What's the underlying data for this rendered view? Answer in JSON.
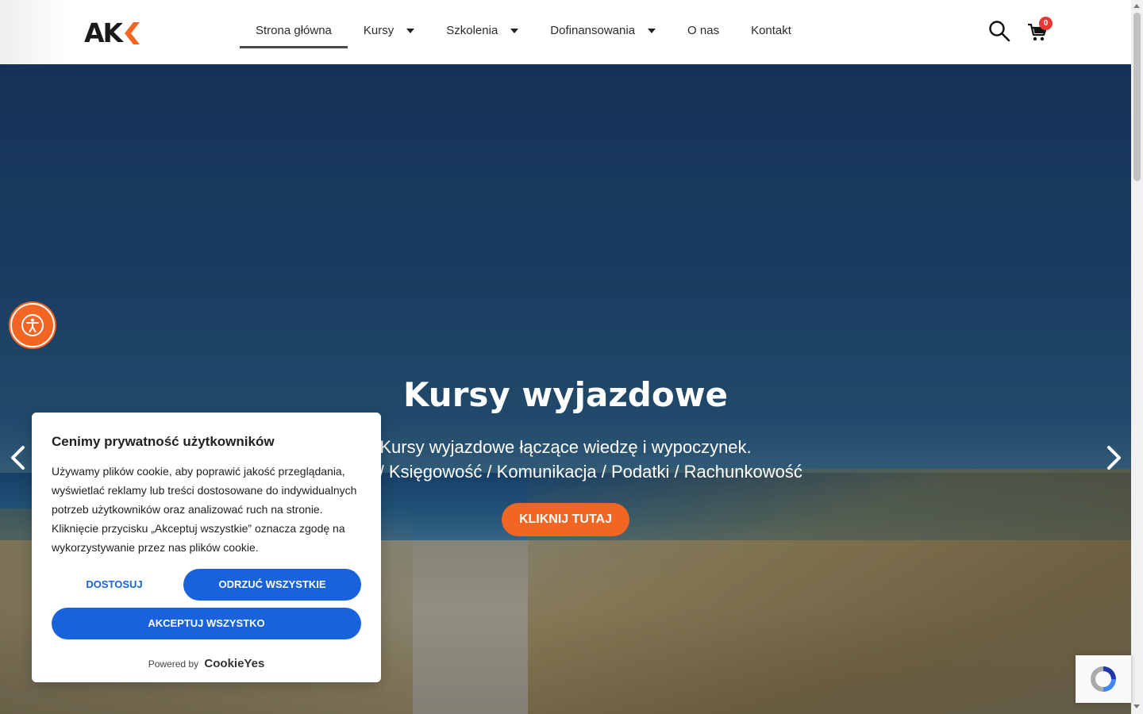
{
  "logo": {
    "text": "AK"
  },
  "nav": {
    "items": [
      {
        "label": "Strona główna",
        "active": true
      },
      {
        "label": "Kursy"
      },
      {
        "label": "Szkolenia"
      },
      {
        "label": "Dofinansowania"
      },
      {
        "label": "O nas"
      },
      {
        "label": "Kontakt"
      }
    ]
  },
  "cart": {
    "count": "0"
  },
  "hero": {
    "title": "Kursy wyjazdowe",
    "line1": "Kursy wyjazdowe łączące wiedzę i wypoczynek.",
    "line2": "Kadry / Księgowość / Komunikacja / Podatki / Rachunkowość",
    "button": "KLIKNIJ TUTAJ"
  },
  "cookie": {
    "title": "Cenimy prywatność użytkowników",
    "text": "Używamy plików cookie, aby poprawić jakość przeglądania, wyświetlać reklamy lub treści dostosowane do indywidualnych potrzeb użytkowników oraz analizować ruch na stronie. Kliknięcie przycisku „Akceptuj wszystkie” oznacza zgodę na wykorzystywanie przez nas plików cookie.",
    "customize": "DOSTOSUJ",
    "reject": "ODRZUĆ WSZYSTKIE",
    "accept": "AKCEPTUJ WSZYSTKO",
    "powered_by": "Powered by",
    "brand": "CookieYes"
  },
  "colors": {
    "accent": "#f26522",
    "cookie_blue": "#1863dc",
    "badge": "#e53935"
  },
  "icons": {
    "search": "search-icon",
    "cart": "cart-icon",
    "accessibility": "accessibility-icon",
    "prev": "chevron-left-icon",
    "next": "chevron-right-icon"
  }
}
